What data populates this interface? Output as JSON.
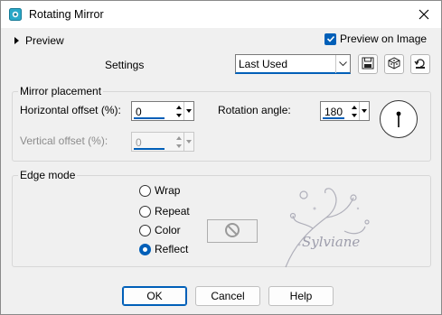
{
  "window": {
    "title": "Rotating Mirror"
  },
  "header": {
    "preview_label": "Preview",
    "preview_on_image_label": "Preview on Image",
    "settings_label": "Settings",
    "preset_value": "Last Used"
  },
  "mirror_placement": {
    "title": "Mirror placement",
    "horizontal_offset_label": "Horizontal offset (%):",
    "horizontal_offset_value": "0",
    "vertical_offset_label": "Vertical offset (%):",
    "vertical_offset_value": "0",
    "rotation_angle_label": "Rotation angle:",
    "rotation_angle_value": "180"
  },
  "edge_mode": {
    "title": "Edge mode",
    "options": [
      "Wrap",
      "Repeat",
      "Color",
      "Reflect"
    ],
    "selected": "Reflect"
  },
  "watermark": {
    "text": "Sylviane"
  },
  "buttons": {
    "ok": "OK",
    "cancel": "Cancel",
    "help": "Help"
  },
  "colors": {
    "accent": "#005fb8",
    "background": "#f0f0f0"
  },
  "icons": [
    "app-icon",
    "close-icon",
    "save-preset-icon",
    "randomize-icon",
    "reset-icon",
    "no-color-icon"
  ]
}
